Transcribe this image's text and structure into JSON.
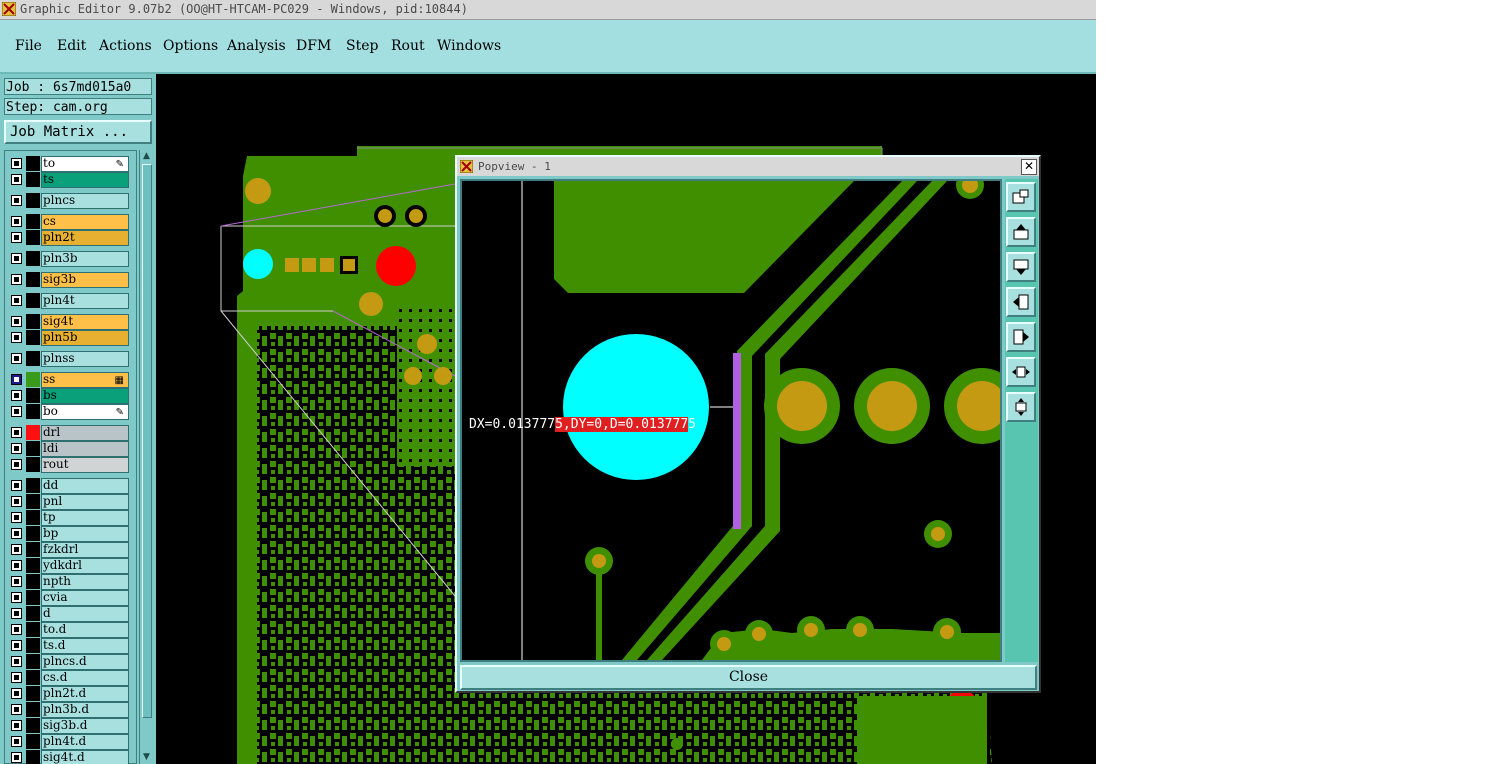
{
  "window": {
    "title": "Graphic Editor 9.07b2 (OO@HT-HTCAM-PC029 - Windows, pid:10844)"
  },
  "menu": [
    {
      "label": "File"
    },
    {
      "label": "Edit"
    },
    {
      "label": "Actions"
    },
    {
      "label": "Options"
    },
    {
      "label": "Analysis"
    },
    {
      "label": "DFM"
    },
    {
      "label": "Step"
    },
    {
      "label": "Rout"
    },
    {
      "label": "Windows"
    }
  ],
  "job": {
    "job_text": "Job : 6s7md015a0",
    "step_text": "Step: cam.org",
    "job_matrix_label": "Job Matrix ..."
  },
  "layers": [
    {
      "name": "to",
      "color": "#ffffff",
      "swatch": "#000000",
      "mark": "pen"
    },
    {
      "name": "ts",
      "color": "#0aa07a",
      "swatch": "#000000"
    },
    {
      "name": "plncs",
      "color": "#a8e0e0",
      "swatch": "#000000"
    },
    {
      "name": "cs",
      "color": "#ffc04a",
      "swatch": "#000000"
    },
    {
      "name": "pln2t",
      "color": "#e8b030",
      "swatch": "#000000"
    },
    {
      "name": "pln3b",
      "color": "#a8e0e0",
      "swatch": "#000000"
    },
    {
      "name": "sig3b",
      "color": "#ffc04a",
      "swatch": "#000000"
    },
    {
      "name": "pln4t",
      "color": "#a8e0e0",
      "swatch": "#000000"
    },
    {
      "name": "sig4t",
      "color": "#ffc04a",
      "swatch": "#000000"
    },
    {
      "name": "pln5b",
      "color": "#e8b030",
      "swatch": "#000000"
    },
    {
      "name": "plnss",
      "color": "#a8e0e0",
      "swatch": "#000000"
    },
    {
      "name": "ss",
      "color": "#ffc04a",
      "swatch": "#3a9a1a",
      "selected": true,
      "mark": "grid"
    },
    {
      "name": "bs",
      "color": "#0aa07a",
      "swatch": "#000000"
    },
    {
      "name": "bo",
      "color": "#ffffff",
      "swatch": "#000000",
      "mark": "pen"
    },
    {
      "name": "drl",
      "color": "#b8c4c8",
      "swatch": "#ff1010"
    },
    {
      "name": "ldi",
      "color": "#b8c4c8",
      "swatch": "#000000"
    },
    {
      "name": "rout",
      "color": "#d0d4d4",
      "swatch": "#000000"
    },
    {
      "name": "dd",
      "color": "#a8e0e0",
      "swatch": "#000000"
    },
    {
      "name": "pnl",
      "color": "#a8e0e0",
      "swatch": "#000000"
    },
    {
      "name": "tp",
      "color": "#a8e0e0",
      "swatch": "#000000"
    },
    {
      "name": "bp",
      "color": "#a8e0e0",
      "swatch": "#000000"
    },
    {
      "name": "fzkdrl",
      "color": "#a8e0e0",
      "swatch": "#000000"
    },
    {
      "name": "ydkdrl",
      "color": "#a8e0e0",
      "swatch": "#000000"
    },
    {
      "name": "npth",
      "color": "#a8e0e0",
      "swatch": "#000000"
    },
    {
      "name": "cvia",
      "color": "#a8e0e0",
      "swatch": "#000000"
    },
    {
      "name": "d",
      "color": "#a8e0e0",
      "swatch": "#000000"
    },
    {
      "name": "to.d",
      "color": "#a8e0e0",
      "swatch": "#000000"
    },
    {
      "name": "ts.d",
      "color": "#a8e0e0",
      "swatch": "#000000"
    },
    {
      "name": "plncs.d",
      "color": "#a8e0e0",
      "swatch": "#000000"
    },
    {
      "name": "cs.d",
      "color": "#a8e0e0",
      "swatch": "#000000"
    },
    {
      "name": "pln2t.d",
      "color": "#a8e0e0",
      "swatch": "#000000"
    },
    {
      "name": "pln3b.d",
      "color": "#a8e0e0",
      "swatch": "#000000"
    },
    {
      "name": "sig3b.d",
      "color": "#a8e0e0",
      "swatch": "#000000"
    },
    {
      "name": "pln4t.d",
      "color": "#a8e0e0",
      "swatch": "#000000"
    },
    {
      "name": "sig4t.d",
      "color": "#a8e0e0",
      "swatch": "#000000"
    }
  ],
  "popview": {
    "title": "Popview - 1",
    "close_label": "Close",
    "measure_plain": "DX=0.013777",
    "measure_highlight": "5,DY=0,D=0.013777",
    "measure_tail": "5",
    "tools": [
      "zoom-window-icon",
      "zoom-in-top-icon",
      "zoom-out-bottom-icon",
      "pan-left-icon",
      "pan-right-icon",
      "fit-horizontal-icon",
      "fit-vertical-icon"
    ]
  },
  "colors": {
    "copper": "#3f8f00",
    "pad": "#c49a12",
    "cyan_pad": "#00ffff",
    "red_pad": "#ff0000",
    "highlight": "#b060e0"
  }
}
